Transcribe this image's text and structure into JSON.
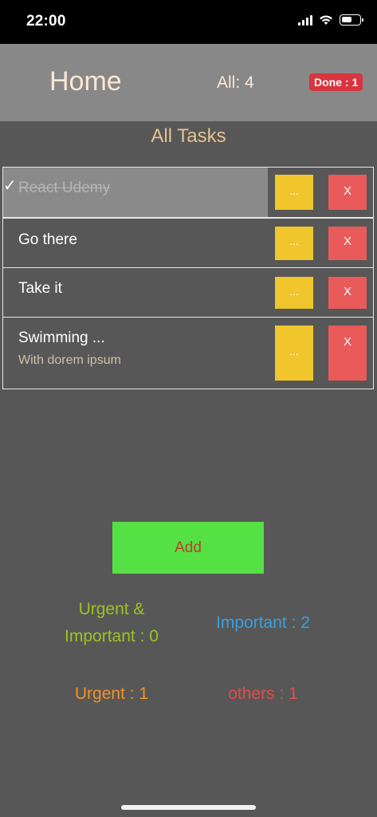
{
  "status_bar": {
    "time": "22:00"
  },
  "header": {
    "title": "Home",
    "all_count": "All: 4",
    "done_badge": "Done : 1"
  },
  "section_title": "All Tasks",
  "tasks": [
    {
      "title": "React Udemy",
      "subtitle": "",
      "done": true,
      "more_label": "...",
      "delete_label": "X"
    },
    {
      "title": "Go there",
      "subtitle": "",
      "done": false,
      "more_label": "...",
      "delete_label": "X"
    },
    {
      "title": "Take it",
      "subtitle": "",
      "done": false,
      "more_label": "...",
      "delete_label": "X"
    },
    {
      "title": "Swimming ...",
      "subtitle": "With dorem ipsum",
      "done": false,
      "more_label": "...",
      "delete_label": "X"
    }
  ],
  "check_mark": "✓",
  "add_label": "Add",
  "stats": {
    "urgent_important": "Urgent & Important : 0",
    "urgent_important_line1": "Urgent &",
    "urgent_important_line2": "Important : 0",
    "important": "Important : 2",
    "urgent": "Urgent : 1",
    "others": "others : 1"
  },
  "colors": {
    "background": "#575757",
    "header": "#888888",
    "more_button": "#f0c62c",
    "delete_button": "#e95a5a",
    "add_button": "#55e043",
    "urgent_important": "#9fc21f",
    "important": "#3aa0e0",
    "urgent": "#f0922a",
    "others": "#e44b4b"
  }
}
